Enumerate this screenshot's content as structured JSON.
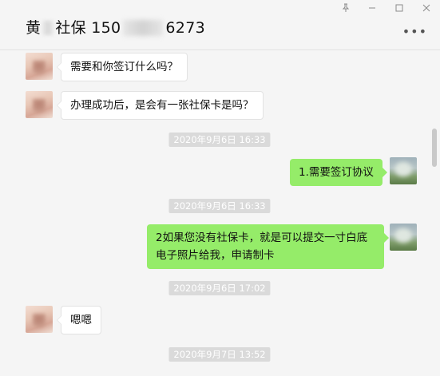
{
  "window": {
    "controls": [
      {
        "name": "pin-icon",
        "glyph": "⊥"
      },
      {
        "name": "minimize-icon",
        "glyph": "—"
      },
      {
        "name": "maximize-icon",
        "glyph": "☐"
      },
      {
        "name": "close-icon",
        "glyph": "✕"
      }
    ]
  },
  "header": {
    "title_prefix": "黄",
    "title_mid": "社保 150",
    "title_suffix": "6273",
    "more_glyph": "•••"
  },
  "messages": [
    {
      "type": "in",
      "text": "需要和你签订什么吗？"
    },
    {
      "type": "in",
      "text": "办理成功后，是会有一张社保卡是吗？"
    },
    {
      "type": "time",
      "text": "2020年9月6日 16:33"
    },
    {
      "type": "out",
      "text": "1.需要签订协议"
    },
    {
      "type": "time",
      "text": "2020年9月6日 16:33"
    },
    {
      "type": "out",
      "text": "2如果您没有社保卡，就是可以提交一寸白底电子照片给我，申请制卡"
    },
    {
      "type": "time",
      "text": "2020年9月6日 17:02"
    },
    {
      "type": "in",
      "text": "嗯嗯"
    },
    {
      "type": "time",
      "text": "2020年9月7日 13:52"
    }
  ],
  "colors": {
    "outgoing_bubble": "#95ec69",
    "incoming_bubble": "#ffffff",
    "background": "#f5f5f5",
    "timestamp_bg": "#dadada"
  }
}
